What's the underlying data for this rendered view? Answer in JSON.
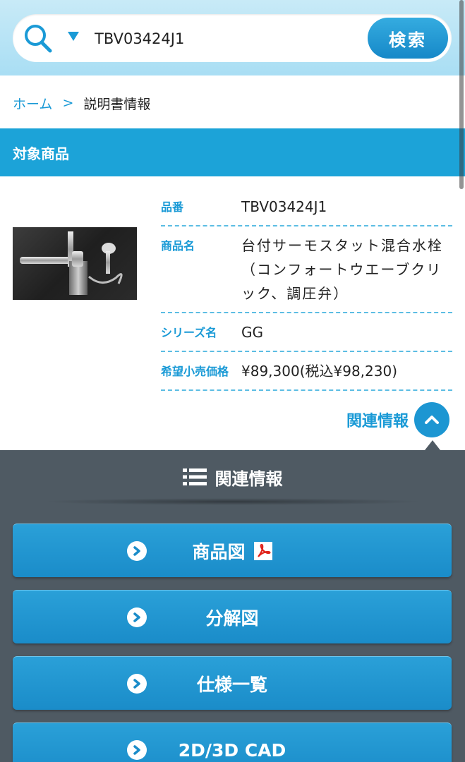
{
  "search": {
    "value": "TBV03424J1",
    "button_label": "検索"
  },
  "breadcrumb": {
    "home": "ホーム",
    "separator": ">",
    "current": "説明書情報"
  },
  "section": {
    "title": "対象商品"
  },
  "product": {
    "specs": [
      {
        "label": "品番",
        "value": "TBV03424J1"
      },
      {
        "label": "商品名",
        "value": "台付サーモスタット混合水栓（コンフォートウエーブクリック、調圧弁）"
      },
      {
        "label": "シリーズ名",
        "value": "GG"
      },
      {
        "label": "希望小売価格",
        "value": "¥89,300(税込¥98,230)"
      }
    ]
  },
  "related": {
    "toggle_label": "関連情報",
    "panel_title": "関連情報",
    "buttons": [
      {
        "label": "商品図",
        "icon": "pdf-icon"
      },
      {
        "label": "分解図"
      },
      {
        "label": "仕様一覧"
      },
      {
        "label": "2D/3D CAD"
      }
    ]
  },
  "colors": {
    "accent": "#1ca3d8",
    "header_bg": "#a9def4",
    "panel_bg": "#4f5a63",
    "button_bg": "#1a8cc9",
    "pdf_red": "#e0231b"
  }
}
